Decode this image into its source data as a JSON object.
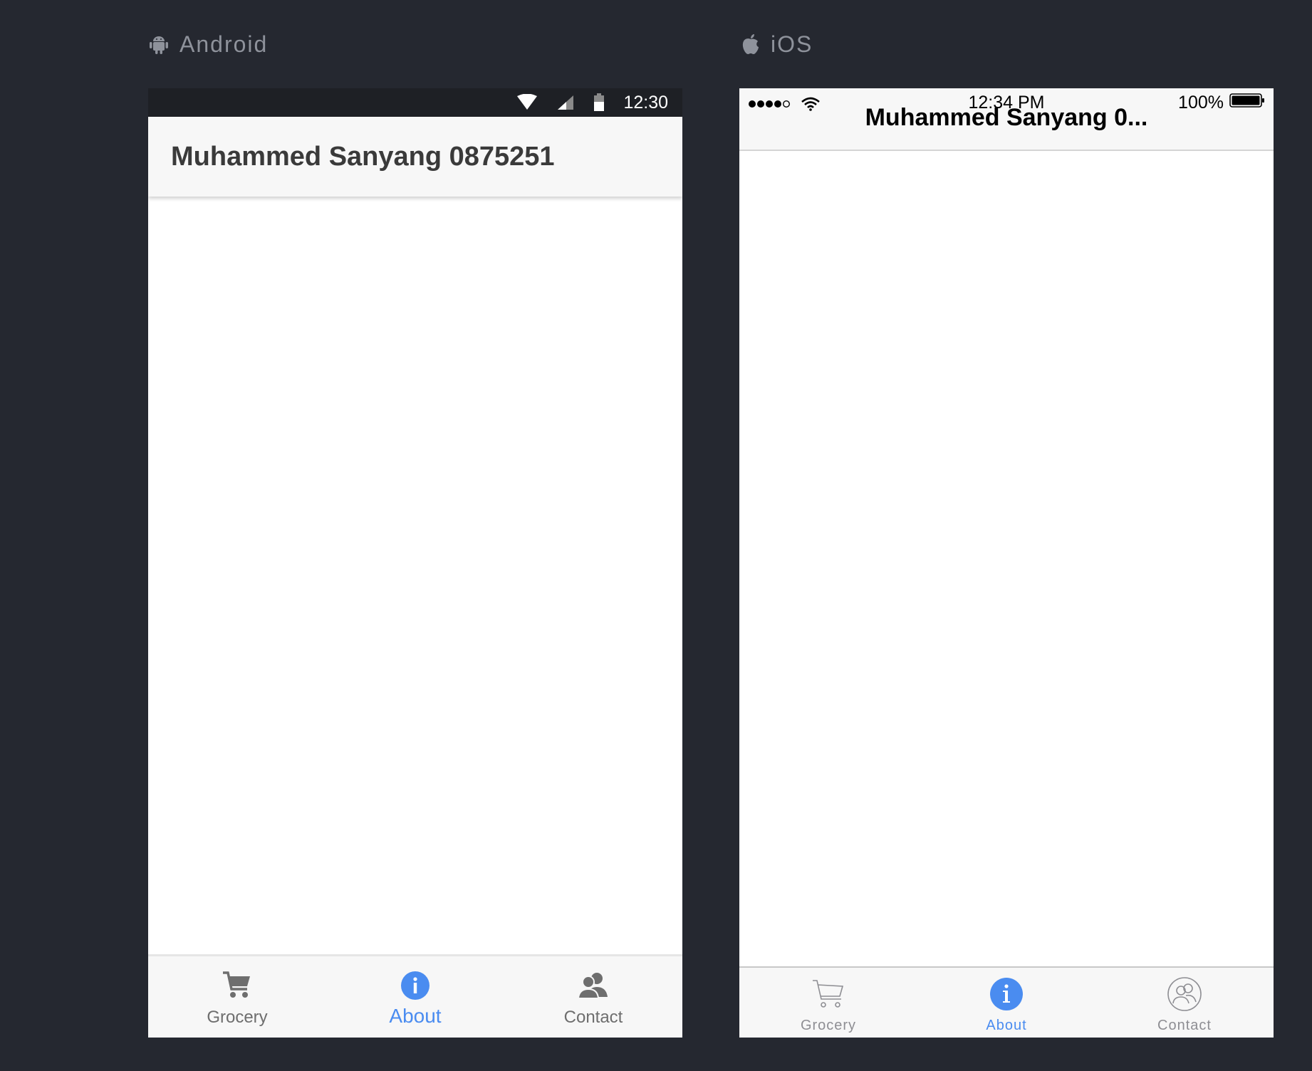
{
  "platforms": {
    "android_label": "Android",
    "ios_label": "iOS"
  },
  "android": {
    "status_time": "12:30",
    "app_title": "Muhammed Sanyang 0875251",
    "tabs": [
      {
        "label": "Grocery",
        "icon": "cart-icon",
        "active": false
      },
      {
        "label": "About",
        "icon": "info-icon",
        "active": true
      },
      {
        "label": "Contact",
        "icon": "contacts-icon",
        "active": false
      }
    ]
  },
  "ios": {
    "status_time": "12:34 PM",
    "battery_text": "100%",
    "nav_title": "Muhammed Sanyang 0...",
    "tabs": [
      {
        "label": "Grocery",
        "icon": "cart-outline-icon",
        "active": false
      },
      {
        "label": "About",
        "icon": "info-icon",
        "active": true
      },
      {
        "label": "Contact",
        "icon": "contacts-outline-icon",
        "active": false
      }
    ]
  },
  "colors": {
    "accent": "#4a8cf0",
    "background": "#252830",
    "bar": "#f7f7f7"
  }
}
